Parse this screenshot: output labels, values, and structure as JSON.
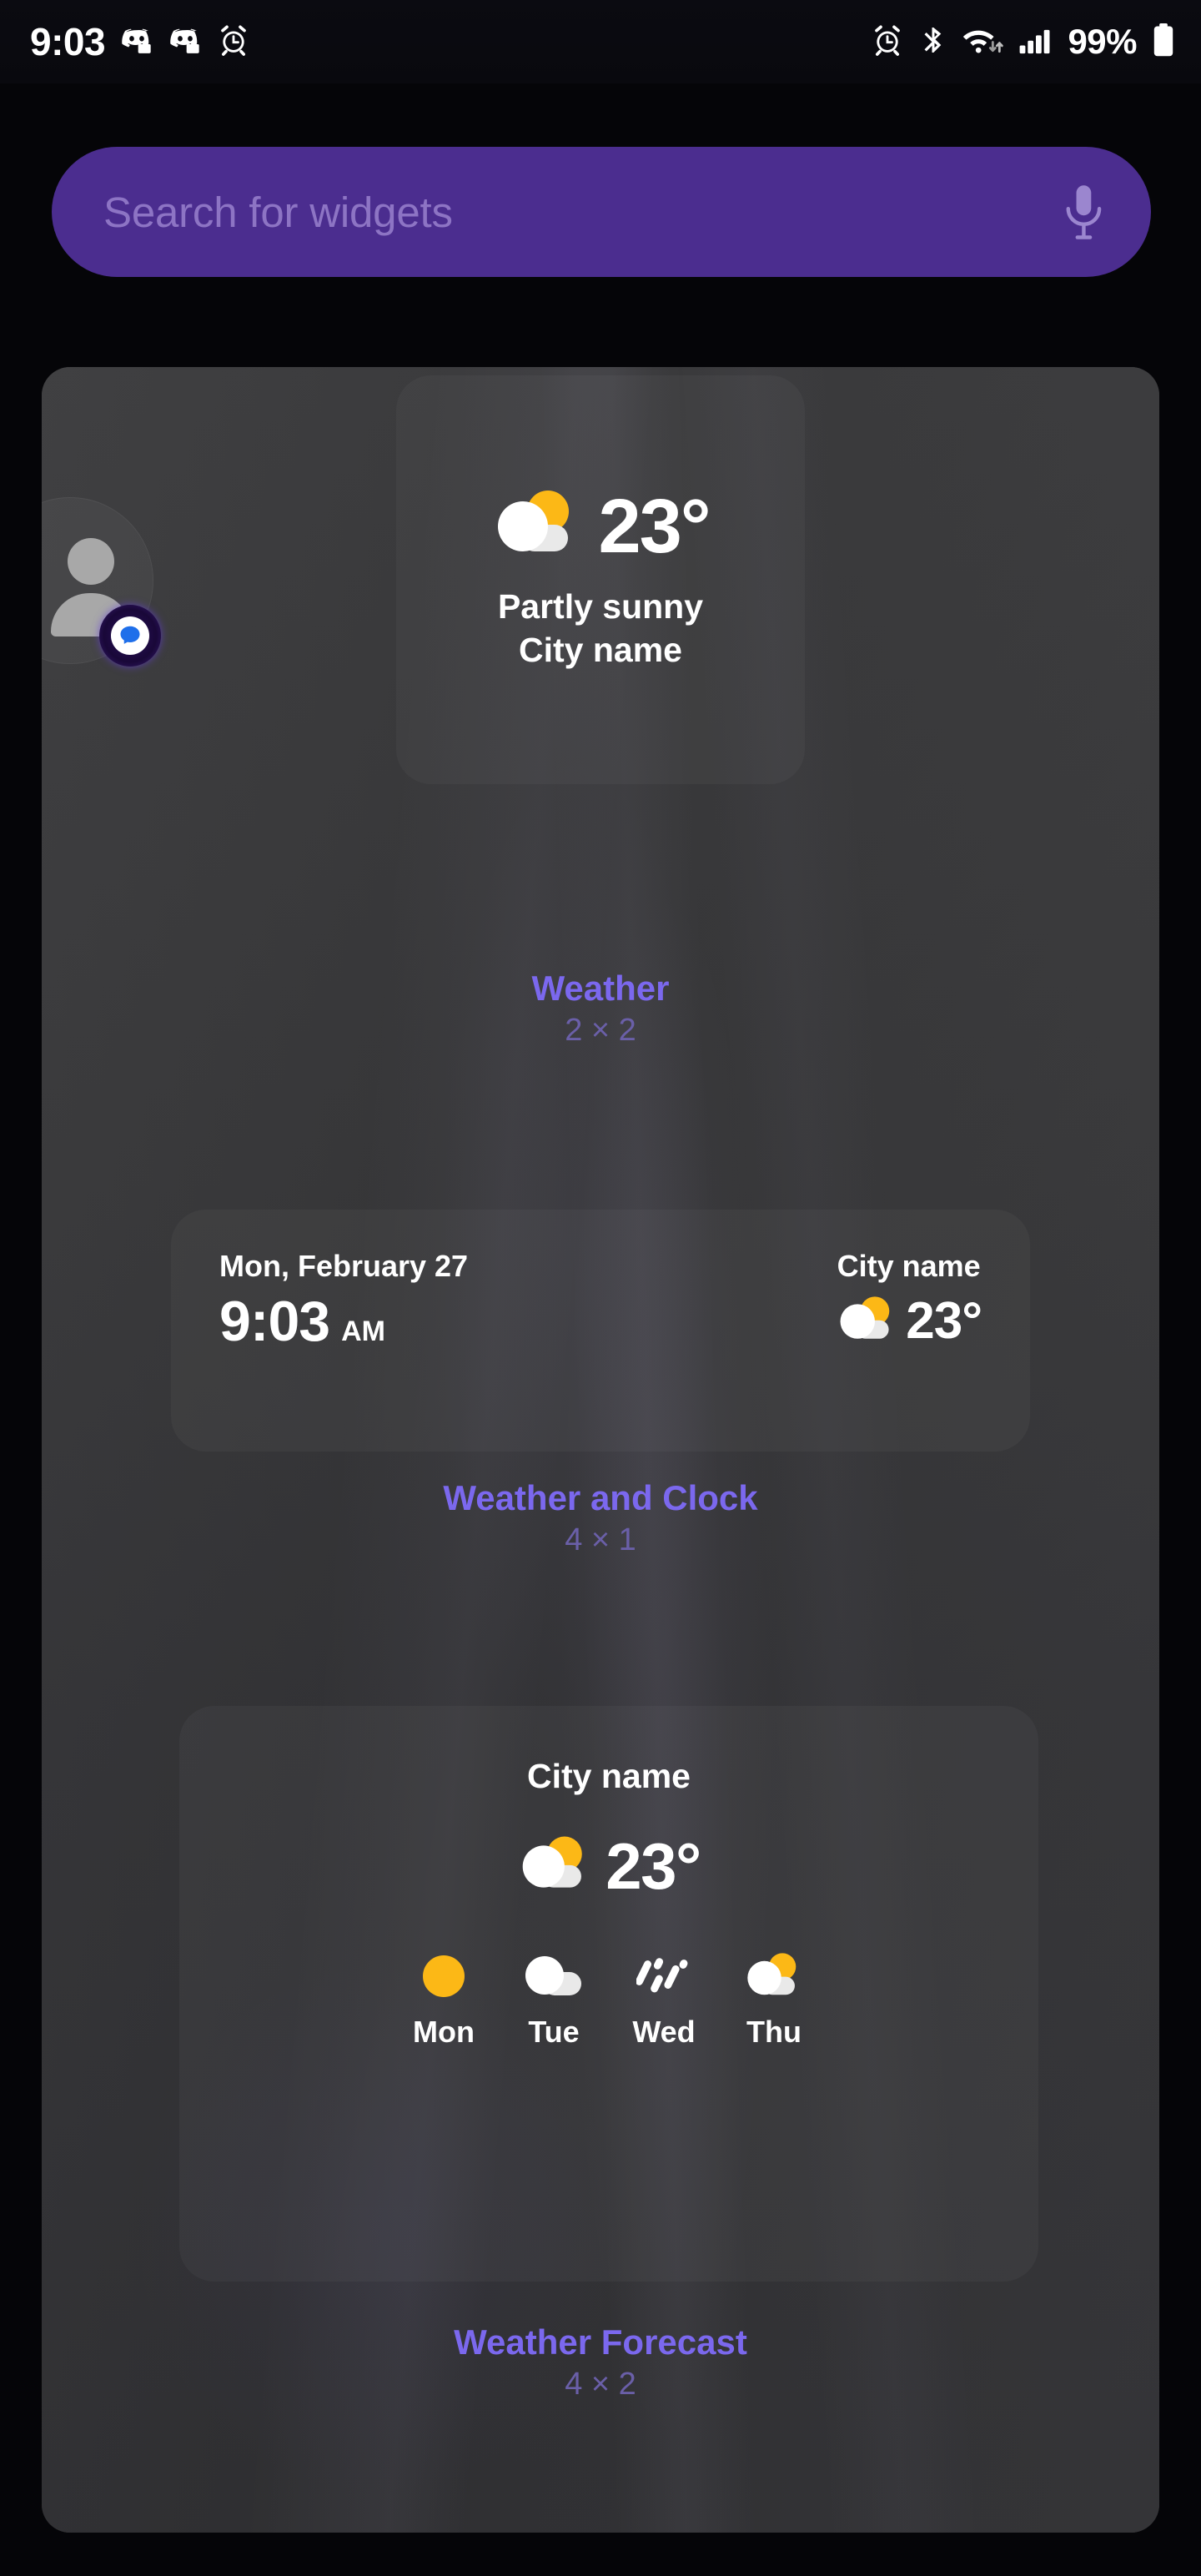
{
  "status_bar": {
    "time": "9:03",
    "battery_percent": "99%",
    "left_icons": [
      "discord-icon",
      "discord-icon",
      "alarm-clock-icon"
    ],
    "right_icons": [
      "alarm-clock-icon",
      "bluetooth-icon",
      "wifi-icon",
      "cellular-signal-icon",
      "battery-icon"
    ]
  },
  "search": {
    "placeholder": "Search for widgets",
    "value": "",
    "mic_icon": "microphone-icon",
    "accent_color": "#4b2d8f",
    "placeholder_color": "#8d74c4"
  },
  "theme": {
    "label_color": "#7b68ee",
    "size_label_color": "#6a5fa8",
    "sun_color": "#fcb816",
    "cloud_color": "#ffffff",
    "cloud_shadow_color": "#e6e6e6",
    "panel_color": "#3a3a3c"
  },
  "peek_icon": {
    "name": "profile-avatar",
    "badge": "chat-bubble-badge"
  },
  "widgets": [
    {
      "id": "weather",
      "label": "Weather",
      "size": "2 × 2",
      "icon": "partly-sunny-icon",
      "temperature": "23°",
      "condition": "Partly sunny",
      "city": "City name"
    },
    {
      "id": "weather-and-clock",
      "label": "Weather and Clock",
      "size": "4 × 1",
      "date": "Mon, February 27",
      "time": "9:03",
      "ampm": "AM",
      "city": "City name",
      "icon": "partly-sunny-icon",
      "temperature": "23°"
    },
    {
      "id": "weather-forecast",
      "label": "Weather Forecast",
      "size": "4 × 2",
      "city": "City name",
      "icon": "partly-sunny-icon",
      "temperature": "23°",
      "forecast": [
        {
          "day": "Mon",
          "icon": "sunny-icon"
        },
        {
          "day": "Tue",
          "icon": "cloudy-icon"
        },
        {
          "day": "Wed",
          "icon": "rainy-icon"
        },
        {
          "day": "Thu",
          "icon": "partly-sunny-icon"
        }
      ]
    }
  ]
}
